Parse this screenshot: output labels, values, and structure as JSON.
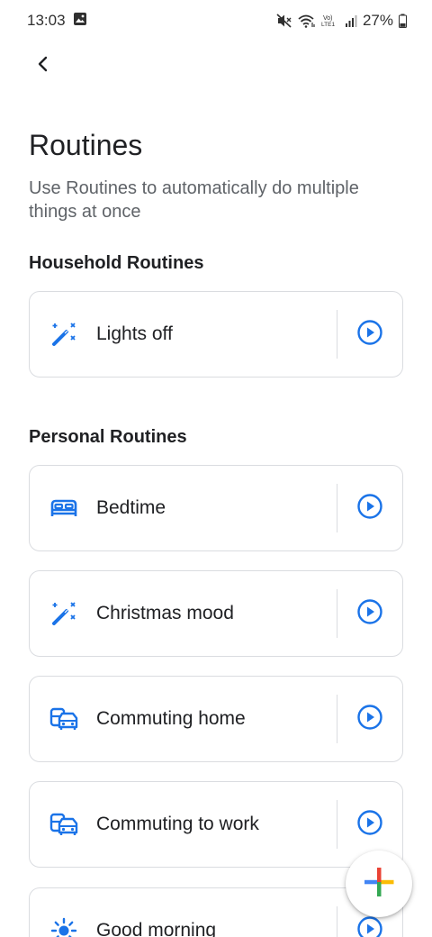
{
  "status_bar": {
    "time": "13:03",
    "battery": "27%",
    "icons": [
      "image-icon",
      "mute-icon",
      "wifi-icon",
      "volte-icon",
      "signal-icon",
      "battery-icon"
    ]
  },
  "header": {
    "back_icon": "chevron-left-icon",
    "title": "Routines",
    "subtitle": "Use Routines to automatically do multiple things at once"
  },
  "household": {
    "heading": "Household Routines",
    "items": [
      {
        "label": "Lights off",
        "icon": "magic-wand-icon"
      }
    ]
  },
  "personal": {
    "heading": "Personal Routines",
    "items": [
      {
        "label": "Bedtime",
        "icon": "bed-icon"
      },
      {
        "label": "Christmas mood",
        "icon": "magic-wand-icon"
      },
      {
        "label": "Commuting home",
        "icon": "commute-icon"
      },
      {
        "label": "Commuting to work",
        "icon": "commute-icon"
      },
      {
        "label": "Good morning",
        "icon": "sun-icon"
      }
    ]
  },
  "fab": {
    "icon": "add-icon"
  },
  "colors": {
    "accent": "#1a73e8",
    "divider": "#dadce0",
    "plus_red": "#ea4335",
    "plus_blue": "#4285f4",
    "plus_yellow": "#fbbc04",
    "plus_green": "#34a853"
  }
}
